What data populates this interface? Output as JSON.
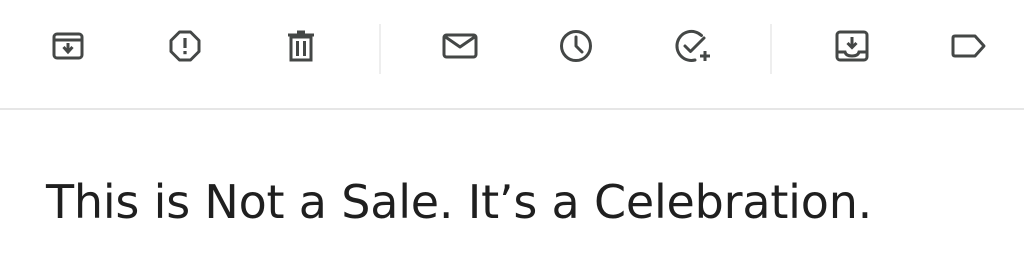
{
  "toolbar": {
    "actions": [
      {
        "name": "archive",
        "icon": "archive-icon"
      },
      {
        "name": "report-spam",
        "icon": "report-spam-icon"
      },
      {
        "name": "delete",
        "icon": "trash-icon"
      },
      {
        "name": "mark-unread",
        "icon": "mail-icon"
      },
      {
        "name": "snooze",
        "icon": "clock-icon"
      },
      {
        "name": "add-to-tasks",
        "icon": "add-task-icon"
      },
      {
        "name": "move-to",
        "icon": "move-to-inbox-icon"
      },
      {
        "name": "labels",
        "icon": "label-icon"
      }
    ],
    "icon_color": "#444746",
    "divider_color": "#e6e6e6"
  },
  "email": {
    "subject": "This is Not a Sale. It’s a Celebration."
  }
}
